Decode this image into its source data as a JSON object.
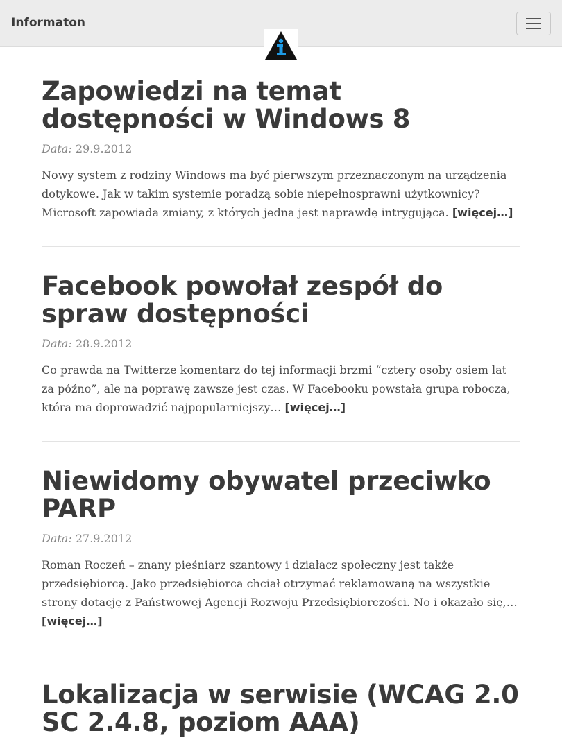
{
  "navbar": {
    "brand": "Informaton",
    "toggle_icon": "hamburger-menu-icon",
    "logo_icon": "information-triangle-logo",
    "logo_colors": {
      "triangle": "#111111",
      "glyph": "#1e9be6"
    }
  },
  "posts": [
    {
      "title": "Zapowiedzi na temat dostępności w Windows 8",
      "date_label": "Data:",
      "date": "29.9.2012",
      "excerpt": "Nowy system z rodziny Windows ma być pierwszym przeznaczonym na urządzenia dotykowe. Jak w takim systemie poradzą sobie niepełnosprawni użytkownicy? Microsoft zapowiada zmiany, z których jedna jest naprawdę intrygująca.",
      "more": "[więcej…]"
    },
    {
      "title": "Facebook powołał zespół do spraw dostępności",
      "date_label": "Data:",
      "date": "28.9.2012",
      "excerpt": "Co prawda na Twitterze komentarz do tej informacji brzmi “cztery osoby osiem lat za późno”, ale na poprawę zawsze jest czas. W Facebooku powstała grupa robocza, która ma doprowadzić najpopularniejszy…",
      "more": "[więcej…]"
    },
    {
      "title": "Niewidomy obywatel przeciwko PARP",
      "date_label": "Data:",
      "date": "27.9.2012",
      "excerpt": "Roman Roczeń – znany pieśniarz szantowy i działacz społeczny jest także przedsiębiorcą. Jako przedsiębiorca chciał otrzymać reklamowaną na wszystkie strony dotację z Państwowej Agencji Rozwoju Przedsiębiorczości. No i okazało się,…",
      "more": "[więcej…]"
    },
    {
      "title": "Lokalizacja w serwisie (WCAG 2.0 SC 2.4.8, poziom AAA)"
    }
  ]
}
